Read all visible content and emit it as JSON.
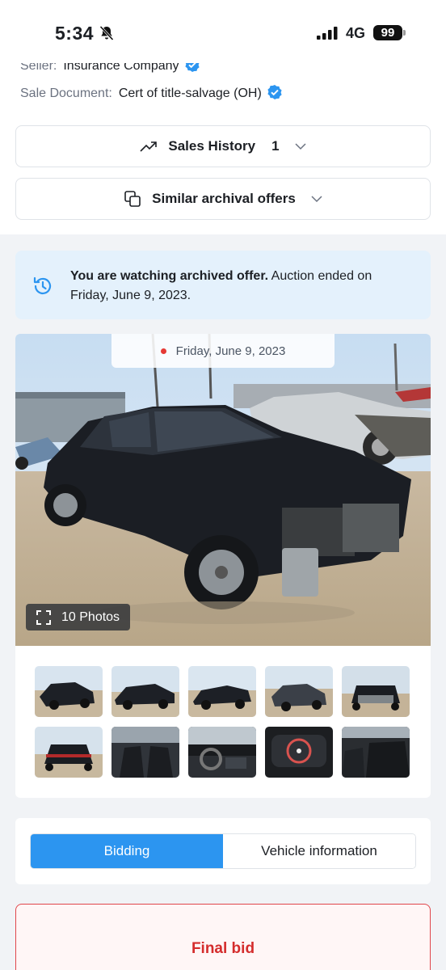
{
  "status_bar": {
    "time": "5:34",
    "network": "4G",
    "battery": "99",
    "bell_muted_icon": "bell-slash-icon",
    "signal_icon": "signal-bars-icon"
  },
  "info": {
    "seller_label": "Seller:",
    "seller_value": "Insurance Company",
    "sale_document_label": "Sale Document:",
    "sale_document_value": "Cert of title-salvage (OH)",
    "verified_icon": "verified-badge-icon"
  },
  "sales_history": {
    "icon": "trend-up-icon",
    "label": "Sales History",
    "count": "1",
    "chevron": "chevron-down-icon"
  },
  "similar_offers": {
    "icon": "copy-icon",
    "label": "Similar archival offers",
    "chevron": "chevron-down-icon"
  },
  "notice": {
    "icon": "history-icon",
    "bold_text": "You are watching archived offer.",
    "text": " Auction ended on Friday, June 9, 2023."
  },
  "gallery": {
    "date": "Friday, June 9, 2023",
    "photos_label": "10 Photos",
    "fullscreen_icon": "fullscreen-icon",
    "thumbnails": [
      "front-left",
      "left-side",
      "right-side",
      "front-right",
      "front",
      "rear",
      "interior-front",
      "dashboard",
      "instrument-cluster",
      "rear-seats"
    ]
  },
  "tabs": {
    "bidding": "Bidding",
    "vehicle_info": "Vehicle information",
    "active": "Bidding"
  },
  "final_bid": {
    "label": "Final bid"
  },
  "colors": {
    "accent": "#2c95f0",
    "notice_bg": "#e4f1fc",
    "final_border": "#e0464b",
    "final_text": "#d42c2c"
  }
}
